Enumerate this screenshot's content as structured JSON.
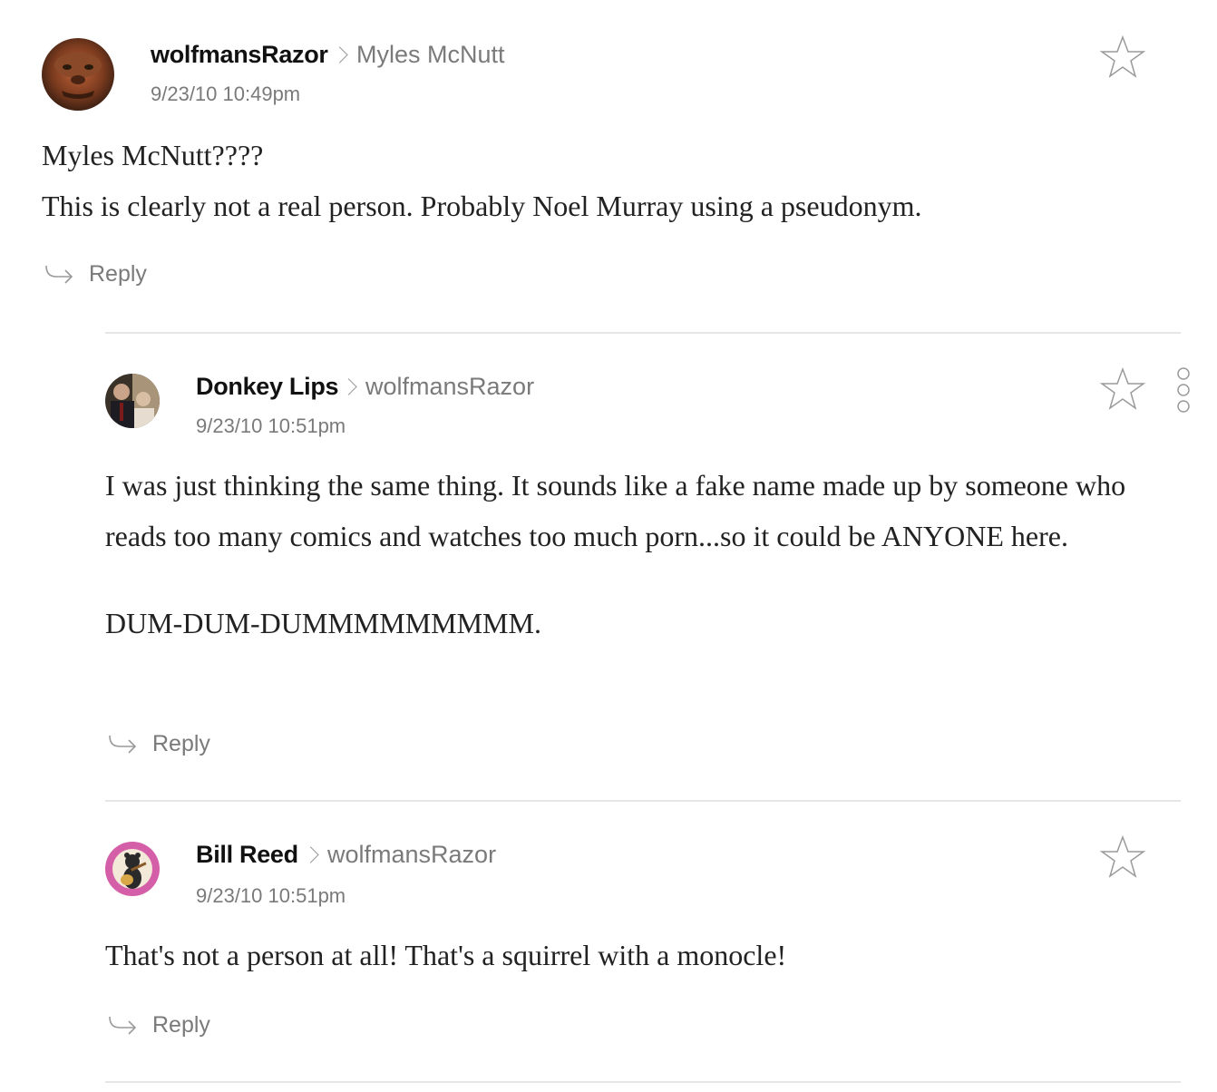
{
  "comments": [
    {
      "author": "wolfmansRazor",
      "reply_to": "Myles McNutt",
      "timestamp": "9/23/10 10:49pm",
      "body": [
        "Myles McNutt????",
        "This is clearly not a real person. Probably Noel Murray using a pseudonym."
      ],
      "reply_label": "Reply",
      "avatar_icon": "werewolf-avatar-icon"
    },
    {
      "author": "Donkey Lips",
      "reply_to": "wolfmansRazor",
      "timestamp": "9/23/10 10:51pm",
      "body": [
        "I was just thinking the same thing. It sounds like a fake name made up by someone who reads too many comics and watches too much porn...so it could be ANYONE here.",
        "DUM-DUM-DUMMMMMMMMM."
      ],
      "reply_label": "Reply",
      "avatar_icon": "photo-avatar-icon"
    },
    {
      "author": "Bill Reed",
      "reply_to": "wolfmansRazor",
      "timestamp": "9/23/10 10:51pm",
      "body": [
        "That's not a person at all! That's a squirrel with a monocle!"
      ],
      "reply_label": "Reply",
      "avatar_icon": "guitar-bear-avatar-icon"
    }
  ],
  "colors": {
    "author": "#111111",
    "meta": "#7a7a7a",
    "body": "#222222",
    "divider": "#e6e6e6"
  }
}
